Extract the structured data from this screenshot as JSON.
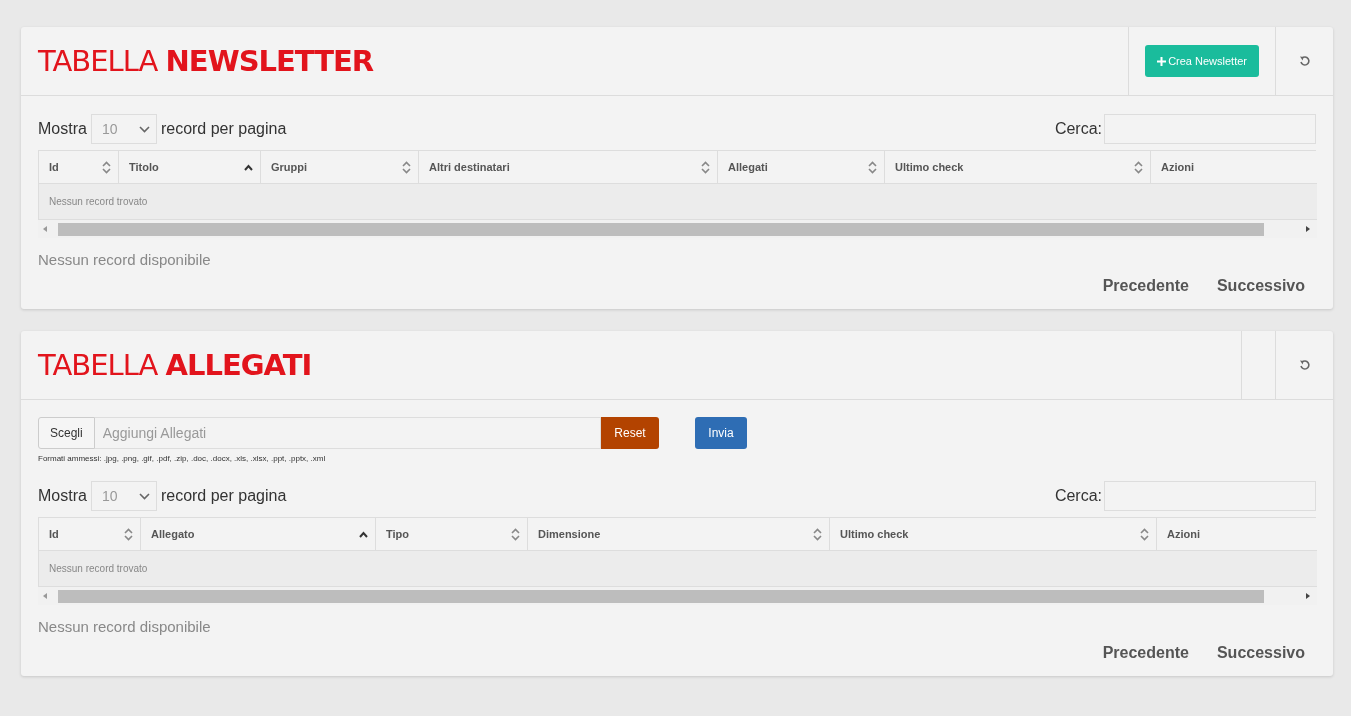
{
  "panels": [
    {
      "title": "TABELLA **NEWSLETTER**",
      "action_button": {
        "label": "Crea Newsletter"
      },
      "length": {
        "before": "Mostra",
        "value": "10",
        "after": "record per pagina"
      },
      "search_label": "Cerca:",
      "columns": [
        {
          "label": "Id",
          "sortable": true,
          "sorted": false
        },
        {
          "label": "Titolo",
          "sortable": true,
          "sorted": true
        },
        {
          "label": "Gruppi",
          "sortable": true,
          "sorted": false
        },
        {
          "label": "Altri destinatari",
          "sortable": true,
          "sorted": false
        },
        {
          "label": "Allegati",
          "sortable": true,
          "sorted": false
        },
        {
          "label": "Ultimo check",
          "sortable": true,
          "sorted": false
        },
        {
          "label": "Azioni",
          "sortable": false,
          "sorted": false
        }
      ],
      "empty_message": "Nessun record trovato",
      "info": "Nessun record disponibile",
      "pagination": [
        "Precedente",
        "Successivo"
      ]
    },
    {
      "title": "TABELLA **ALLEGATI**",
      "upload": {
        "choose": "Scegli",
        "placeholder": "Aggiungi Allegati",
        "reset": "Reset",
        "submit": "Invia",
        "hint": "Formati ammessi: .jpg, .png, .gif, .pdf, .zip, .doc, .docx, .xls, .xlsx, .ppt, .pptx, .xml"
      },
      "length": {
        "before": "Mostra",
        "value": "10",
        "after": "record per pagina"
      },
      "search_label": "Cerca:",
      "columns": [
        {
          "label": "Id",
          "sortable": true,
          "sorted": false
        },
        {
          "label": "Allegato",
          "sortable": true,
          "sorted": true
        },
        {
          "label": "Tipo",
          "sortable": true,
          "sorted": false
        },
        {
          "label": "Dimensione",
          "sortable": true,
          "sorted": false
        },
        {
          "label": "Ultimo check",
          "sortable": true,
          "sorted": false
        },
        {
          "label": "Azioni",
          "sortable": false,
          "sorted": false
        }
      ],
      "empty_message": "Nessun record trovato",
      "info": "Nessun record disponibile",
      "pagination": [
        "Precedente",
        "Successivo"
      ]
    }
  ]
}
